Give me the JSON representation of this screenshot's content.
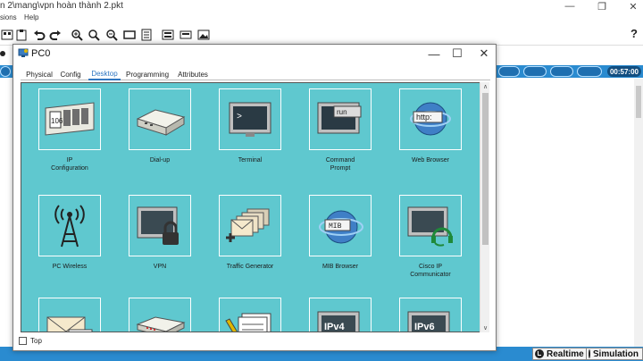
{
  "main_window": {
    "title": "n 2\\mang\\vpn hoàn thành 2.pkt",
    "controls": {
      "minimize": "—",
      "maximize": "❐",
      "close": "✕"
    },
    "menu": [
      "sions",
      "Help"
    ],
    "help": "?",
    "clock": "00:57:00"
  },
  "mode_buttons": {
    "realtime": "Realtime",
    "simulation": "Simulation"
  },
  "dialog": {
    "title": "PC0",
    "controls": {
      "minimize": "—",
      "maximize": "☐",
      "close": "✕"
    },
    "tabs": [
      {
        "label": "Physical",
        "active": false
      },
      {
        "label": "Config",
        "active": false
      },
      {
        "label": "Desktop",
        "active": true
      },
      {
        "label": "Programming",
        "active": false
      },
      {
        "label": "Attributes",
        "active": false
      }
    ],
    "apps": [
      {
        "label": "IP\nConfiguration",
        "icon": "ip-configuration-icon"
      },
      {
        "label": "Dial-up",
        "icon": "dial-up-modem-icon"
      },
      {
        "label": "Terminal",
        "icon": "terminal-icon"
      },
      {
        "label": "Command\nPrompt",
        "icon": "command-prompt-icon"
      },
      {
        "label": "Web Browser",
        "icon": "web-browser-icon"
      },
      {
        "label": "PC Wireless",
        "icon": "wireless-antenna-icon"
      },
      {
        "label": "VPN",
        "icon": "vpn-lock-icon"
      },
      {
        "label": "Traffic Generator",
        "icon": "traffic-generator-icon"
      },
      {
        "label": "MIB Browser",
        "icon": "mib-browser-icon"
      },
      {
        "label": "Cisco IP Communicator",
        "icon": "ip-communicator-icon"
      },
      {
        "label": "",
        "icon": "email-icon"
      },
      {
        "label": "",
        "icon": "pppoe-dialer-icon"
      },
      {
        "label": "",
        "icon": "text-editor-icon"
      },
      {
        "label": "",
        "icon": "ipv4-firewall-icon",
        "screen_text": "IPv4"
      },
      {
        "label": "",
        "icon": "ipv6-firewall-icon",
        "screen_text": "IPv6"
      }
    ],
    "top_checkbox": {
      "label": "Top",
      "checked": false
    },
    "scroll_arrows": {
      "up": "∧",
      "down": "∨"
    }
  },
  "colors": {
    "desktop_bg": "#5fc8cf",
    "status_bar": "#2a8bd0",
    "active_tab": "#2f77c2"
  }
}
